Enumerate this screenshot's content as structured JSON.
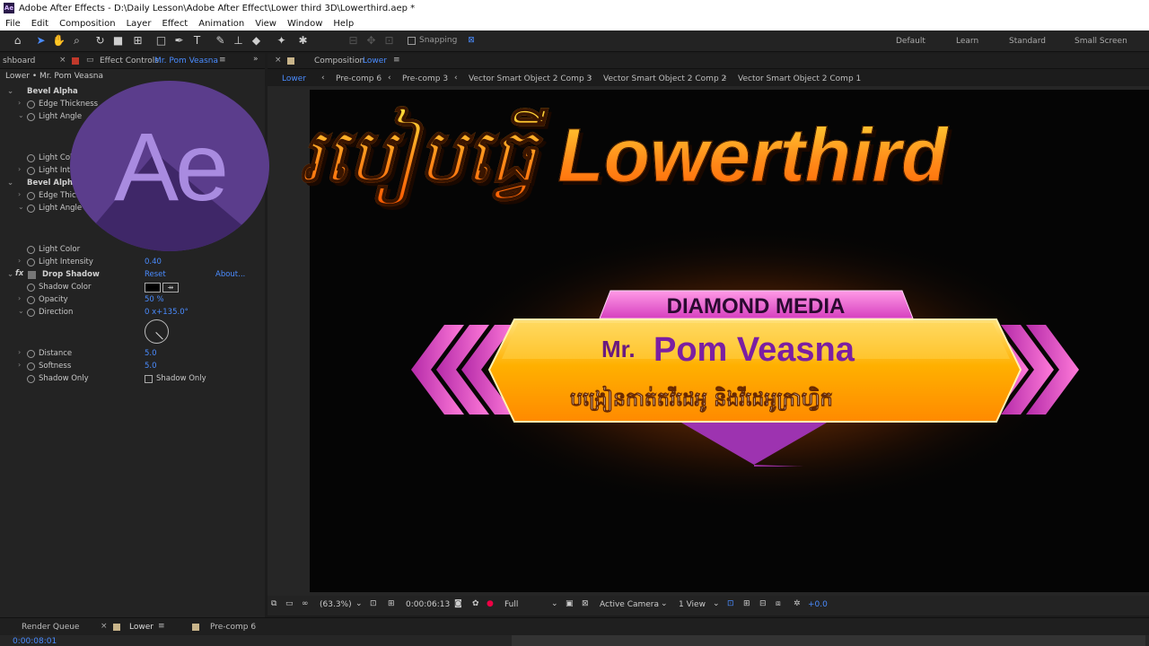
{
  "app": {
    "icon_label": "Ae",
    "title": "Adobe After Effects - D:\\Daily Lesson\\Adobe After Effect\\Lower third 3D\\Lowerthird.aep *"
  },
  "menu": [
    "File",
    "Edit",
    "Composition",
    "Layer",
    "Effect",
    "Animation",
    "View",
    "Window",
    "Help"
  ],
  "toolbar": {
    "snapping_label": "Snapping",
    "workspaces": [
      "Default",
      "Learn",
      "Standard",
      "Small Screen"
    ]
  },
  "left_panel": {
    "tab_project": "shboard",
    "tab_effect_controls_prefix": "Effect Controls",
    "tab_effect_controls_layer": "Mr. Pom Veasna",
    "layer_header": "Lower • Mr. Pom Veasna",
    "rows": [
      {
        "type": "group",
        "label": "Bevel Alpha"
      },
      {
        "type": "prop",
        "label": "Edge Thickness",
        "value": ""
      },
      {
        "type": "prop",
        "label": "Light Angle",
        "value": ""
      },
      {
        "type": "prop",
        "label": "Light Color",
        "value": ""
      },
      {
        "type": "prop",
        "label": "Light Intensity",
        "value": ""
      },
      {
        "type": "group",
        "label": "Bevel Alpha"
      },
      {
        "type": "prop",
        "label": "Edge Thickness",
        "value": ""
      },
      {
        "type": "prop",
        "label": "Light Angle",
        "value": ""
      },
      {
        "type": "prop",
        "label": "Light Color",
        "value": ""
      },
      {
        "type": "prop",
        "label": "Light Intensity",
        "value": "0.40"
      }
    ],
    "drop_shadow": {
      "fx_label": "fx",
      "label": "Drop Shadow",
      "reset": "Reset",
      "about": "About...",
      "shadow_color_label": "Shadow Color",
      "opacity_label": "Opacity",
      "opacity_value": "50 %",
      "direction_label": "Direction",
      "direction_value": "0 x+135.0°",
      "distance_label": "Distance",
      "distance_value": "5.0",
      "softness_label": "Softness",
      "softness_value": "5.0",
      "shadow_only_label": "Shadow Only",
      "shadow_only_checkbox": "Shadow Only"
    }
  },
  "composition": {
    "tab_prefix": "Composition",
    "tab_name": "Lower",
    "breadcrumbs": [
      "Lower",
      "Pre-comp 6",
      "Pre-comp 3",
      "Vector Smart Object 2 Comp 3",
      "Vector Smart Object 2 Comp 2",
      "Vector Smart Object 2 Comp 1"
    ],
    "lower_third": {
      "top_label": "DIAMOND MEDIA",
      "name_prefix": "Mr.",
      "name": "Pom Veasna",
      "subtitle": "បង្រៀនកាត់តវីដេអូ និងវីដេអូក្រាហ្វិក"
    }
  },
  "viewer_bar": {
    "zoom": "(63.3%)",
    "timecode": "0:00:06:13",
    "resolution": "Full",
    "camera": "Active Camera",
    "views": "1 View",
    "exposure": "+0.0"
  },
  "bottom": {
    "render_queue": "Render Queue",
    "tab_lower": "Lower",
    "tab_precomp": "Pre-comp 6",
    "timecode": "0:00:08:01"
  },
  "overlay": {
    "title": "របៀបធ្វើ Lowerthird",
    "logo_text": "Ae"
  },
  "colors": {
    "accent": "#4a8cff",
    "ae_purple": "#5b3d8c",
    "title_orange": "#ff7a1a",
    "banner_gold": "#ffb000",
    "chevron_pink": "#e040c0"
  }
}
